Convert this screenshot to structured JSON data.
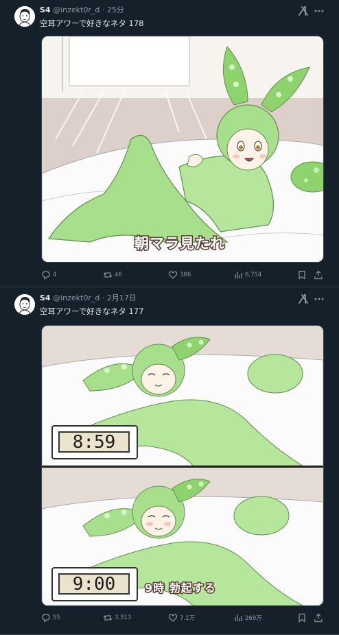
{
  "tweets": [
    {
      "name": "S4",
      "handle": "@inzekt0r_d",
      "dot": "·",
      "time": "25分",
      "text": "空耳アワーで好きなネタ 178",
      "caption": "朝マラ見たれ",
      "replies": "4",
      "reposts": "46",
      "likes": "386",
      "views": "6,754"
    },
    {
      "name": "S4",
      "handle": "@inzekt0r_d",
      "dot": "·",
      "time": "2月17日",
      "text": "空耳アワーで好きなネタ 177",
      "clock_top": "8:59",
      "clock_bottom": "9:00",
      "caption": "9時 勃起する",
      "replies": "55",
      "reposts": "3,513",
      "likes": "7.1万",
      "views": "269万"
    }
  ],
  "colors": {
    "background": "#15202b",
    "muted": "#8b98a5",
    "text": "#e7e9ea",
    "character_green": "#a8df8c"
  },
  "icons": [
    "grok-icon",
    "more-icon",
    "reply-icon",
    "repost-icon",
    "like-icon",
    "views-icon",
    "bookmark-icon",
    "share-icon"
  ]
}
